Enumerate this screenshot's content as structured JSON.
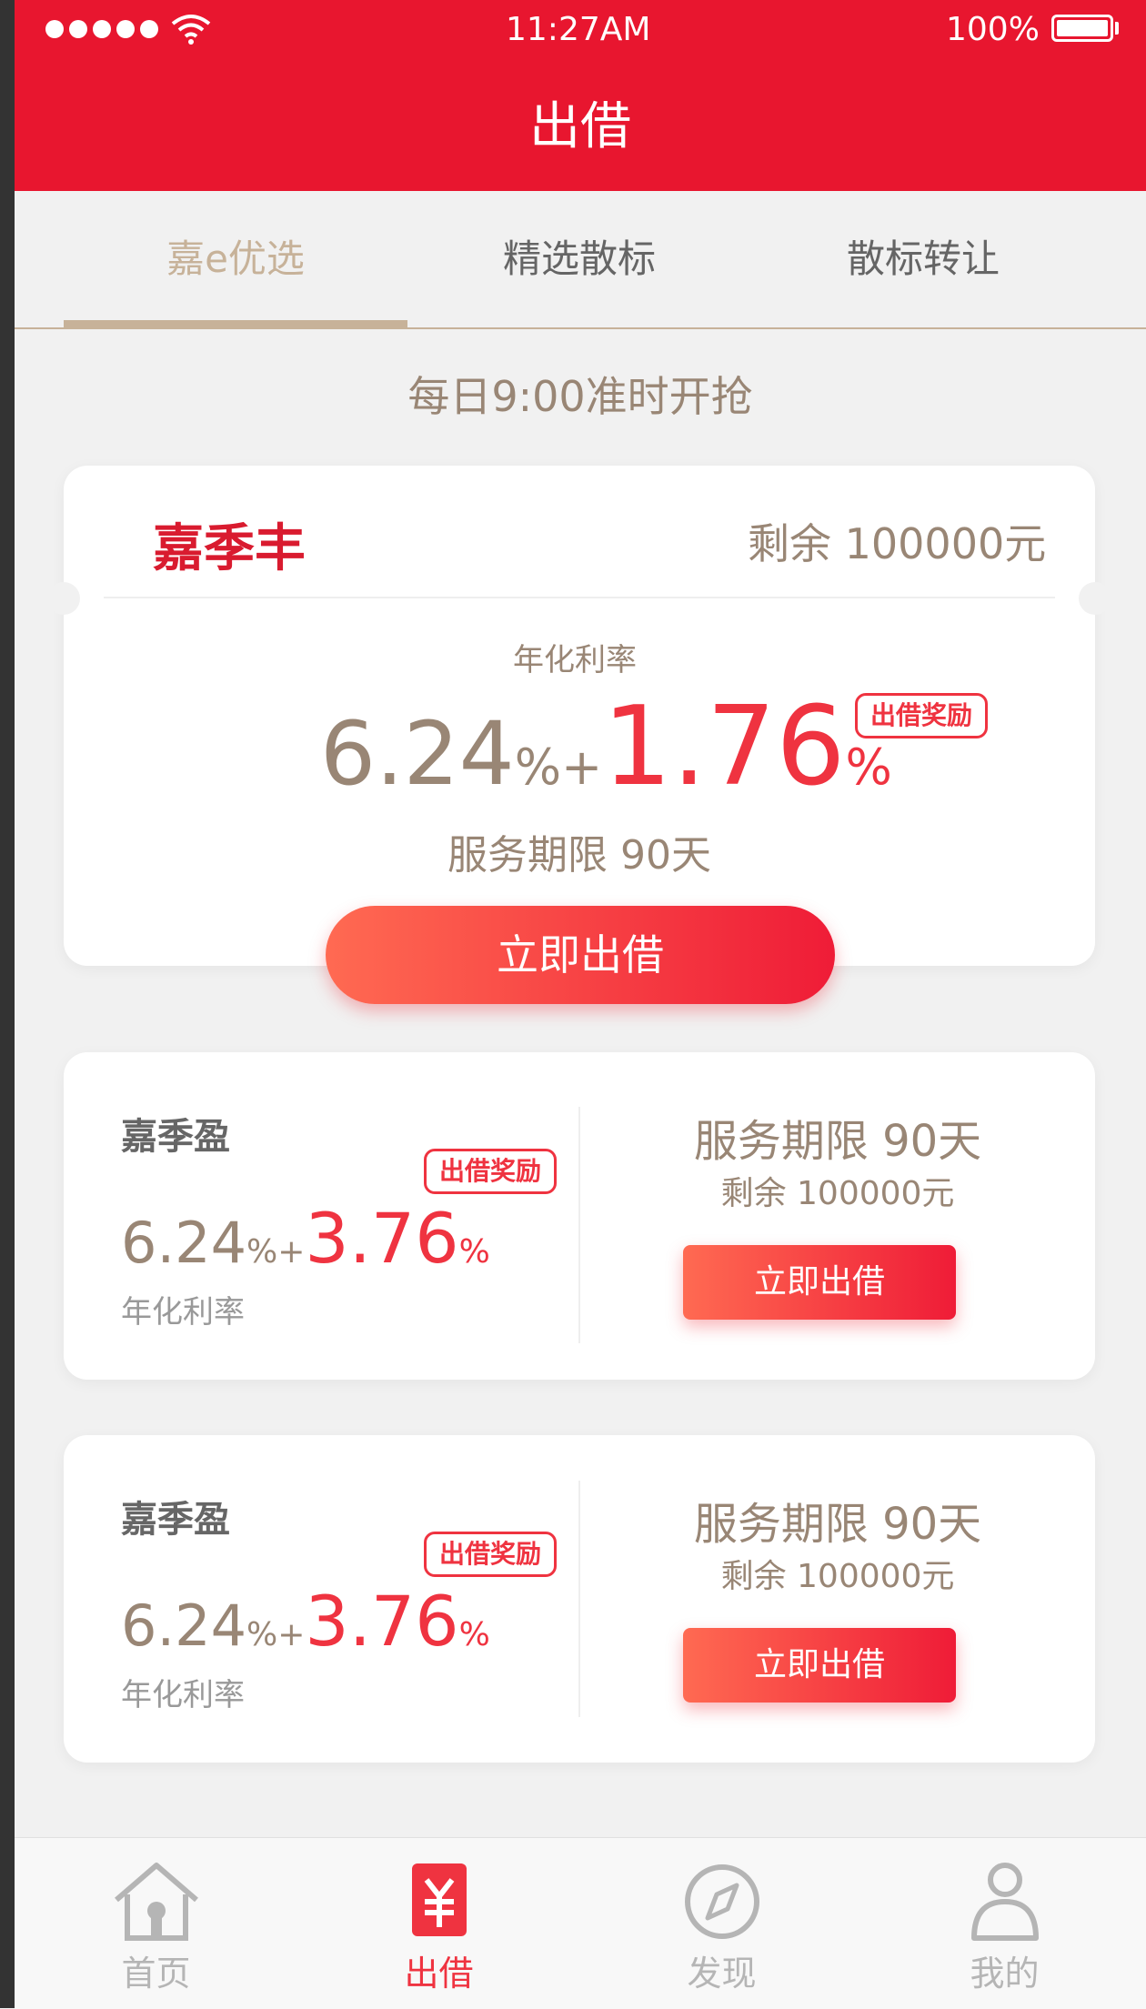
{
  "status_bar": {
    "time": "11:27AM",
    "battery": "100%"
  },
  "header": {
    "title": "出借"
  },
  "tabs": [
    {
      "label": "嘉e优选",
      "active": true
    },
    {
      "label": "精选散标",
      "active": false
    },
    {
      "label": "散标转让",
      "active": false
    }
  ],
  "notice": "每日9:00准时开抢",
  "featured": {
    "name": "嘉季丰",
    "remaining": "剩余 100000元",
    "rate_label": "年化利率",
    "base_rate": "6.24",
    "base_unit": "%+",
    "bonus_rate": "1.76",
    "bonus_unit": "%",
    "badge": "出借奖励",
    "term": "服务期限  90天",
    "button": "立即出借"
  },
  "products": [
    {
      "name": "嘉季盈",
      "badge": "出借奖励",
      "base_rate": "6.24",
      "base_unit": "%+",
      "bonus_rate": "3.76",
      "bonus_unit": "%",
      "rate_label": "年化利率",
      "term": "服务期限  90天",
      "remaining": "剩余 100000元",
      "button": "立即出借"
    },
    {
      "name": "嘉季盈",
      "badge": "出借奖励",
      "base_rate": "6.24",
      "base_unit": "%+",
      "bonus_rate": "3.76",
      "bonus_unit": "%",
      "rate_label": "年化利率",
      "term": "服务期限  90天",
      "remaining": "剩余 100000元",
      "button": "立即出借"
    }
  ],
  "nav": [
    {
      "label": "首页",
      "icon": "home-icon",
      "active": false
    },
    {
      "label": "出借",
      "icon": "yen-icon",
      "active": true
    },
    {
      "label": "发现",
      "icon": "compass-icon",
      "active": false
    },
    {
      "label": "我的",
      "icon": "user-icon",
      "active": false
    }
  ],
  "colors": {
    "brand_red": "#e8162f",
    "accent_red": "#ef3340",
    "gold": "#c7b299",
    "tab_text": "#656565",
    "muted_brown": "#998675"
  }
}
